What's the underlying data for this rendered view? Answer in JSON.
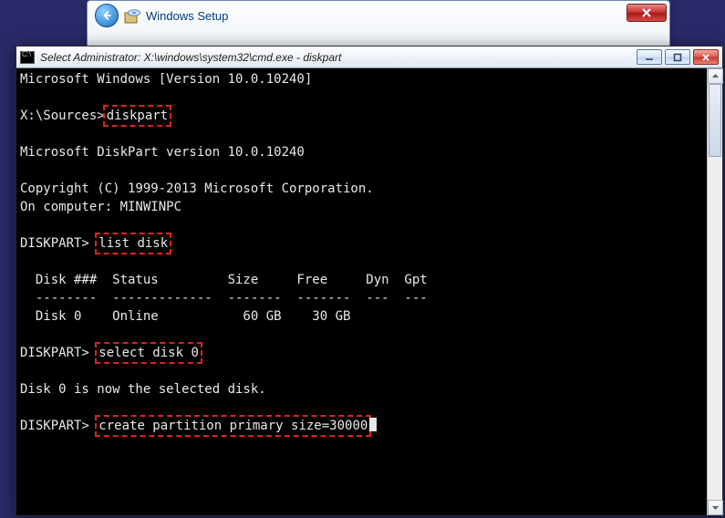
{
  "setup": {
    "title": "Windows Setup"
  },
  "cmd": {
    "title": "Select Administrator: X:\\windows\\system32\\cmd.exe - diskpart",
    "lines": {
      "l1": "Microsoft Windows [Version 10.0.10240]",
      "blank": "",
      "prompt1_pre": "X:\\Sources>",
      "prompt1_cmd": "diskpart",
      "l2": "Microsoft DiskPart version 10.0.10240",
      "l3": "Copyright (C) 1999-2013 Microsoft Corporation.",
      "l4": "On computer: MINWINPC",
      "prompt2_pre": "DISKPART> ",
      "prompt2_cmd": "list disk",
      "tbl_header": "  Disk ###  Status         Size     Free     Dyn  Gpt",
      "tbl_divider": "  --------  -------------  -------  -------  ---  ---",
      "tbl_row0": "  Disk 0    Online           60 GB    30 GB",
      "prompt3_pre": "DISKPART> ",
      "prompt3_cmd": "select disk 0",
      "l5": "Disk 0 is now the selected disk.",
      "prompt4_pre": "DISKPART> ",
      "prompt4_cmd": "create partition primary size=30000"
    }
  }
}
